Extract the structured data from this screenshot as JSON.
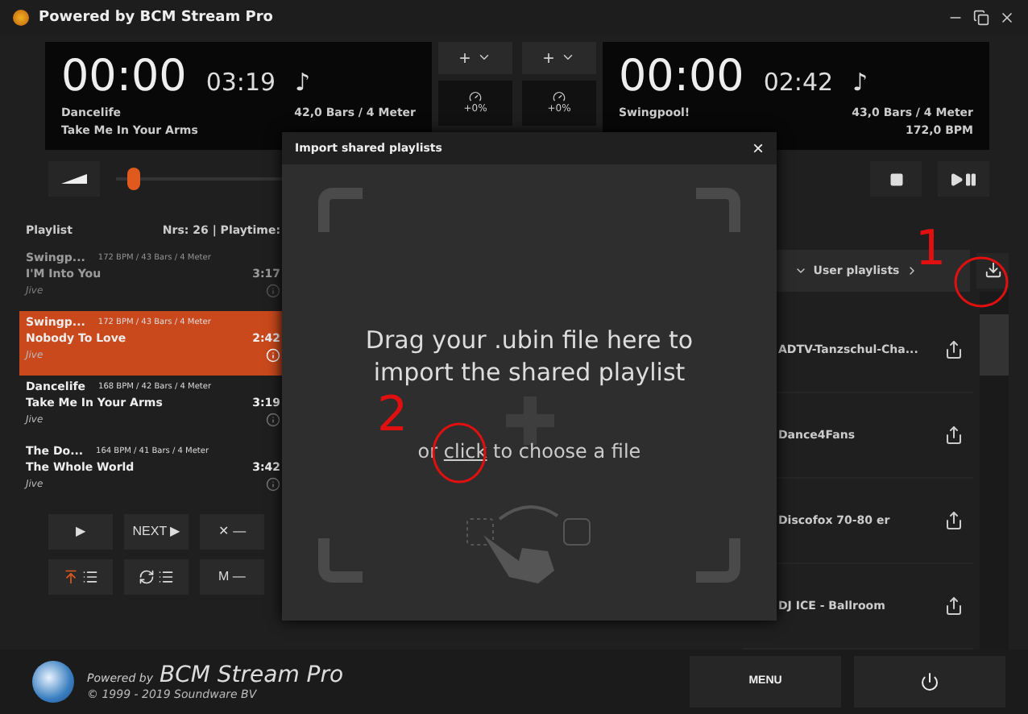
{
  "window": {
    "title": "Powered by BCM Stream Pro"
  },
  "decks": [
    {
      "elapsed": "00:00",
      "remaining": "03:19",
      "note": "♪",
      "artist": "Dancelife",
      "title": "Take Me In Your Arms",
      "bars": "42,0 Bars / 4 Meter"
    },
    {
      "elapsed": "00:00",
      "remaining": "02:42",
      "note": "♪",
      "artist": "Swingpool!",
      "bars": "43,0 Bars / 4 Meter",
      "bpm": "172,0 BPM"
    }
  ],
  "deck_controls": [
    {
      "add": "+",
      "tempo": "+0%"
    },
    {
      "add": "+",
      "tempo": "+0%"
    }
  ],
  "volume": {
    "level": 0.02
  },
  "playlist": {
    "title": "Playlist",
    "summary": "Nrs: 26 | Playtime:",
    "items": [
      {
        "artist": "Swingp...",
        "meta": "172 BPM / 43 Bars / 4 Meter",
        "title": "I'M Into You",
        "duration": "3:17",
        "genre": "Jive",
        "played": true,
        "selected": false
      },
      {
        "artist": "Swingp...",
        "meta": "172 BPM / 43 Bars / 4 Meter",
        "title": "Nobody To Love",
        "duration": "2:42",
        "genre": "Jive",
        "played": false,
        "selected": true
      },
      {
        "artist": "Dancelife",
        "meta": "168 BPM / 42 Bars / 4 Meter",
        "title": "Take Me In Your Arms",
        "duration": "3:19",
        "genre": "Jive",
        "played": false,
        "selected": false
      },
      {
        "artist": "The Do...",
        "meta": "164 BPM / 41 Bars / 4 Meter",
        "title": "The Whole World",
        "duration": "3:42",
        "genre": "Jive",
        "played": false,
        "selected": false
      }
    ]
  },
  "playlist_buttons": [
    [
      {
        "kind": "play",
        "label": "▶"
      },
      {
        "kind": "text",
        "label": "NEXT ▶"
      },
      {
        "kind": "text",
        "label": "✕ —"
      }
    ],
    [
      {
        "kind": "to-top"
      },
      {
        "kind": "shuffle"
      },
      {
        "kind": "text",
        "label": "M —"
      }
    ]
  ],
  "user_playlists": {
    "label": "User playlists",
    "items": [
      "ADTV-Tanzschul-Cha...",
      "Dance4Fans",
      "Discofox 70-80 er",
      "DJ ICE - Ballroom"
    ]
  },
  "dialog": {
    "title": "Import shared playlists",
    "close": "×",
    "message": "Drag your .ubin file here to import the shared playlist",
    "choose_prefix": "or",
    "choose_link": "click",
    "choose_suffix": "to choose a file"
  },
  "annotations": [
    {
      "label": "1"
    },
    {
      "label": "2"
    }
  ],
  "footer": {
    "powered": "Powered by",
    "brand": "BCM Stream Pro",
    "copyright": "© 1999 - 2019 Soundware BV",
    "menu": "MENU"
  }
}
